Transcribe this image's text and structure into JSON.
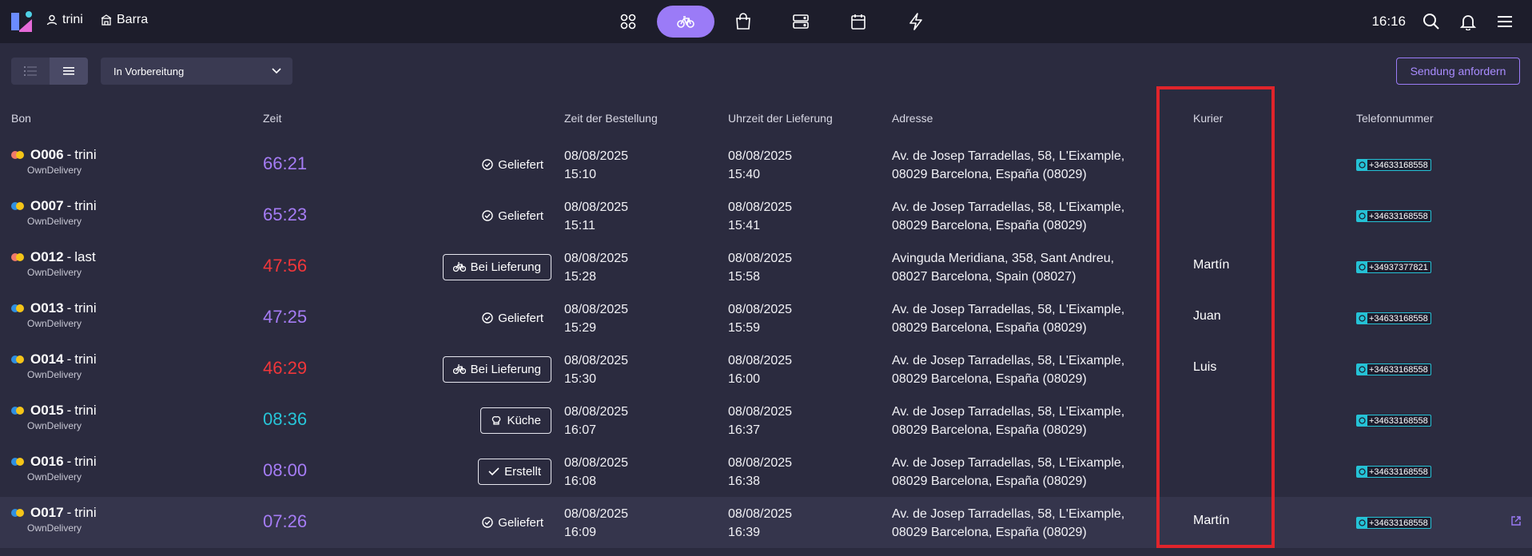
{
  "header": {
    "user": "trini",
    "store": "Barra",
    "time": "16:16",
    "nav_icons": [
      "grid-icon",
      "bicycle-icon",
      "shopping-bag-icon",
      "server-icon",
      "calendar-icon",
      "lightning-icon"
    ],
    "accent": "#9b7bf7"
  },
  "toolbar": {
    "filter_value": "In Vorbereitung",
    "request_button": "Sendung anfordern"
  },
  "table": {
    "columns": {
      "bon": "Bon",
      "zeit": "Zeit",
      "order_time": "Zeit der Bestellung",
      "delivery_time": "Uhrzeit der Lieferung",
      "address": "Adresse",
      "courier": "Kurier",
      "phone": "Telefonnummer"
    },
    "rows": [
      {
        "id": "O006",
        "name": "trini",
        "type": "OwnDelivery",
        "dot": "#f07a6a",
        "timer": "66:21",
        "timer_color": "#a57cf5",
        "status": "Geliefert",
        "status_style": "check",
        "order_date": "08/08/2025",
        "order_time": "15:10",
        "delivery_date": "08/08/2025",
        "delivery_time": "15:40",
        "address1": "Av. de Josep Tarradellas, 58, L'Eixample,",
        "address2": "08029 Barcelona, España (08029)",
        "courier": "",
        "phone": "+34633168558"
      },
      {
        "id": "O007",
        "name": "trini",
        "type": "OwnDelivery",
        "dot": "#2f8fe0",
        "timer": "65:23",
        "timer_color": "#a57cf5",
        "status": "Geliefert",
        "status_style": "check",
        "order_date": "08/08/2025",
        "order_time": "15:11",
        "delivery_date": "08/08/2025",
        "delivery_time": "15:41",
        "address1": "Av. de Josep Tarradellas, 58, L'Eixample,",
        "address2": "08029 Barcelona, España (08029)",
        "courier": "",
        "phone": "+34633168558"
      },
      {
        "id": "O012",
        "name": "last",
        "type": "OwnDelivery",
        "dot": "#f07a6a",
        "timer": "47:56",
        "timer_color": "#f0363a",
        "status": "Bei Lieferung",
        "status_style": "bike",
        "order_date": "08/08/2025",
        "order_time": "15:28",
        "delivery_date": "08/08/2025",
        "delivery_time": "15:58",
        "address1": "Avinguda Meridiana, 358, Sant Andreu,",
        "address2": "08027 Barcelona, Spain (08027)",
        "courier": "Martín",
        "phone": "+34937377821"
      },
      {
        "id": "O013",
        "name": "trini",
        "type": "OwnDelivery",
        "dot": "#2f8fe0",
        "timer": "47:25",
        "timer_color": "#a57cf5",
        "status": "Geliefert",
        "status_style": "check",
        "order_date": "08/08/2025",
        "order_time": "15:29",
        "delivery_date": "08/08/2025",
        "delivery_time": "15:59",
        "address1": "Av. de Josep Tarradellas, 58, L'Eixample,",
        "address2": "08029 Barcelona, España (08029)",
        "courier": "Juan",
        "phone": "+34633168558"
      },
      {
        "id": "O014",
        "name": "trini",
        "type": "OwnDelivery",
        "dot": "#2f8fe0",
        "timer": "46:29",
        "timer_color": "#f0363a",
        "status": "Bei Lieferung",
        "status_style": "bike",
        "order_date": "08/08/2025",
        "order_time": "15:30",
        "delivery_date": "08/08/2025",
        "delivery_time": "16:00",
        "address1": "Av. de Josep Tarradellas, 58, L'Eixample,",
        "address2": "08029 Barcelona, España (08029)",
        "courier": "Luis",
        "phone": "+34633168558"
      },
      {
        "id": "O015",
        "name": "trini",
        "type": "OwnDelivery",
        "dot": "#2f8fe0",
        "timer": "08:36",
        "timer_color": "#27c5d8",
        "status": "Küche",
        "status_style": "chef",
        "order_date": "08/08/2025",
        "order_time": "16:07",
        "delivery_date": "08/08/2025",
        "delivery_time": "16:37",
        "address1": "Av. de Josep Tarradellas, 58, L'Eixample,",
        "address2": "08029 Barcelona, España (08029)",
        "courier": "",
        "phone": "+34633168558"
      },
      {
        "id": "O016",
        "name": "trini",
        "type": "OwnDelivery",
        "dot": "#2f8fe0",
        "timer": "08:00",
        "timer_color": "#a57cf5",
        "status": "Erstellt",
        "status_style": "tick",
        "order_date": "08/08/2025",
        "order_time": "16:08",
        "delivery_date": "08/08/2025",
        "delivery_time": "16:38",
        "address1": "Av. de Josep Tarradellas, 58, L'Eixample,",
        "address2": "08029 Barcelona, España (08029)",
        "courier": "",
        "phone": "+34633168558"
      },
      {
        "id": "O017",
        "name": "trini",
        "type": "OwnDelivery",
        "dot": "#2f8fe0",
        "timer": "07:26",
        "timer_color": "#a57cf5",
        "status": "Geliefert",
        "status_style": "check",
        "order_date": "08/08/2025",
        "order_time": "16:09",
        "delivery_date": "08/08/2025",
        "delivery_time": "16:39",
        "address1": "Av. de Josep Tarradellas, 58, L'Eixample,",
        "address2": "08029 Barcelona, España (08029)",
        "courier": "Martín",
        "phone": "+34633168558"
      }
    ]
  }
}
